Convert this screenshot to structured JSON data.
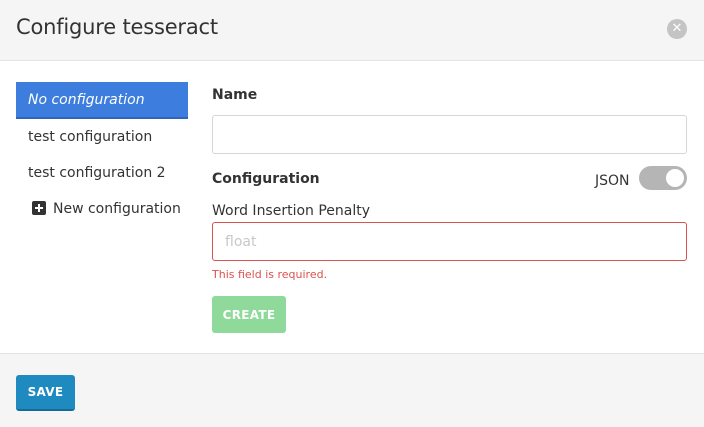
{
  "header": {
    "title": "Configure tesseract",
    "close_icon": "close-icon"
  },
  "sidebar": {
    "items": [
      {
        "label": "No configuration",
        "active": true
      },
      {
        "label": "test configuration",
        "active": false
      },
      {
        "label": "test configuration 2",
        "active": false
      }
    ],
    "add_label": "New configuration"
  },
  "form": {
    "name_label": "Name",
    "name_value": "",
    "configuration_label": "Configuration",
    "json_label": "JSON",
    "json_toggle_on": false,
    "word_insertion_penalty_label": "Word Insertion Penalty",
    "word_insertion_penalty_placeholder": "float",
    "error_text": "This field is required.",
    "create_label": "CREATE"
  },
  "footer": {
    "save_label": "SAVE"
  },
  "colors": {
    "active_item": "#3c7ddd",
    "error": "#d9534f",
    "create_button": "#8fd99b",
    "save_button": "#1f8ac0"
  }
}
